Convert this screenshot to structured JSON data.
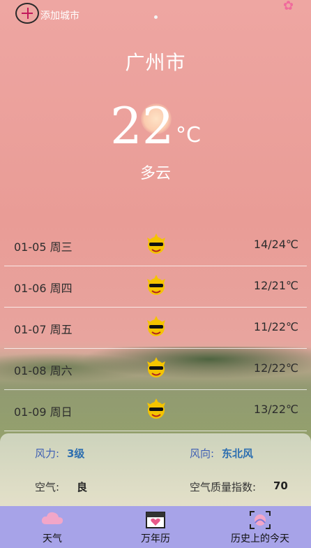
{
  "header": {
    "add_city_label": "添加城市"
  },
  "current": {
    "city": "广州市",
    "temperature": "22",
    "unit": "°C",
    "condition": "多云"
  },
  "forecast": [
    {
      "date": "01-05  周三",
      "range": "14/24℃"
    },
    {
      "date": "01-06  周四",
      "range": "12/21℃"
    },
    {
      "date": "01-07  周五",
      "range": "11/22℃"
    },
    {
      "date": "01-08  周六",
      "range": "12/22℃"
    },
    {
      "date": "01-09  周日",
      "range": "13/22℃"
    }
  ],
  "details": {
    "wind_force_label": "风力:",
    "wind_force_value": "3级",
    "wind_dir_label": "风向:",
    "wind_dir_value": "东北风",
    "air_label": "空气:",
    "air_value": "良",
    "aqi_label": "空气质量指数:",
    "aqi_value": "70"
  },
  "tabs": [
    {
      "label": "天气",
      "icon": "cloud-icon"
    },
    {
      "label": "万年历",
      "icon": "calendar-icon"
    },
    {
      "label": "历史上的今天",
      "icon": "history-icon"
    }
  ],
  "colors": {
    "tabbar": "#a7a3e8",
    "accent": "#c2185b"
  }
}
